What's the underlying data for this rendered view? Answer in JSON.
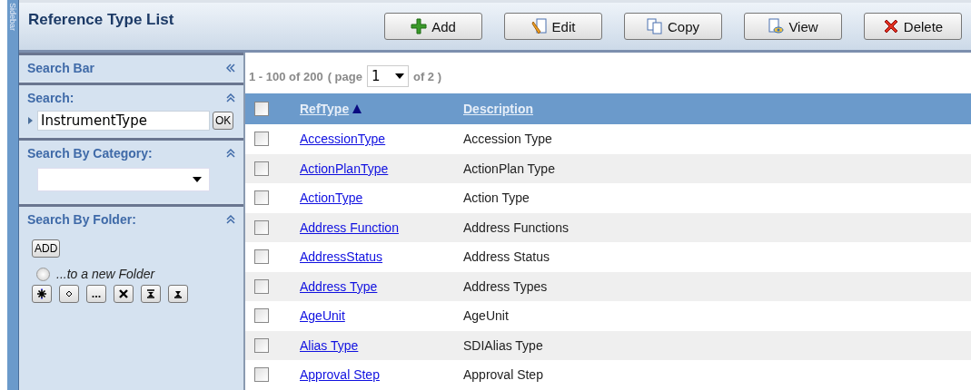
{
  "sidebar_tab": {
    "label": "Sidebar"
  },
  "title": "Reference Type List",
  "toolbar": [
    {
      "label": "Add",
      "kind": "add"
    },
    {
      "label": "Edit",
      "kind": "edit"
    },
    {
      "label": "Copy",
      "kind": "copy"
    },
    {
      "label": "View",
      "kind": "view"
    },
    {
      "label": "Delete",
      "kind": "delete"
    }
  ],
  "search_bar": {
    "title": "Search Bar",
    "search": {
      "title": "Search:",
      "value": "InstrumentType",
      "button": "OK"
    },
    "category": {
      "title": "Search By Category:"
    },
    "folder": {
      "title": "Search By Folder:",
      "add_button": "ADD",
      "radio": {
        "label": "...to a new Folder",
        "selected": false
      },
      "tools": [
        {
          "kind": "asterisk"
        },
        {
          "kind": "diamond"
        },
        {
          "kind": "ellipsis"
        },
        {
          "kind": "cross"
        },
        {
          "kind": "top"
        },
        {
          "kind": "bottom"
        }
      ]
    }
  },
  "pager": {
    "range": "1 - 100 of 200",
    "page_label": "( page",
    "page": "1",
    "of": "of 2 )"
  },
  "table": {
    "select_all": {
      "checked": false
    },
    "columns": [
      {
        "label": "RefType",
        "sorted": true
      },
      {
        "label": "Description",
        "sorted": false
      }
    ],
    "rows": [
      {
        "ref_type": "AccessionType",
        "description": "Accession Type",
        "checked": false
      },
      {
        "ref_type": "ActionPlanType",
        "description": "ActionPlan Type",
        "checked": false
      },
      {
        "ref_type": "ActionType",
        "description": "Action Type",
        "checked": false
      },
      {
        "ref_type": "Address Function",
        "description": "Address Functions",
        "checked": false
      },
      {
        "ref_type": "AddressStatus",
        "description": "Address Status",
        "checked": false
      },
      {
        "ref_type": "Address Type",
        "description": "Address Types",
        "checked": false
      },
      {
        "ref_type": "AgeUnit",
        "description": "AgeUnit",
        "checked": false
      },
      {
        "ref_type": "Alias Type",
        "description": "SDIAlias Type",
        "checked": false
      },
      {
        "ref_type": "Approval Step",
        "description": "Approval Step",
        "checked": false
      }
    ]
  }
}
